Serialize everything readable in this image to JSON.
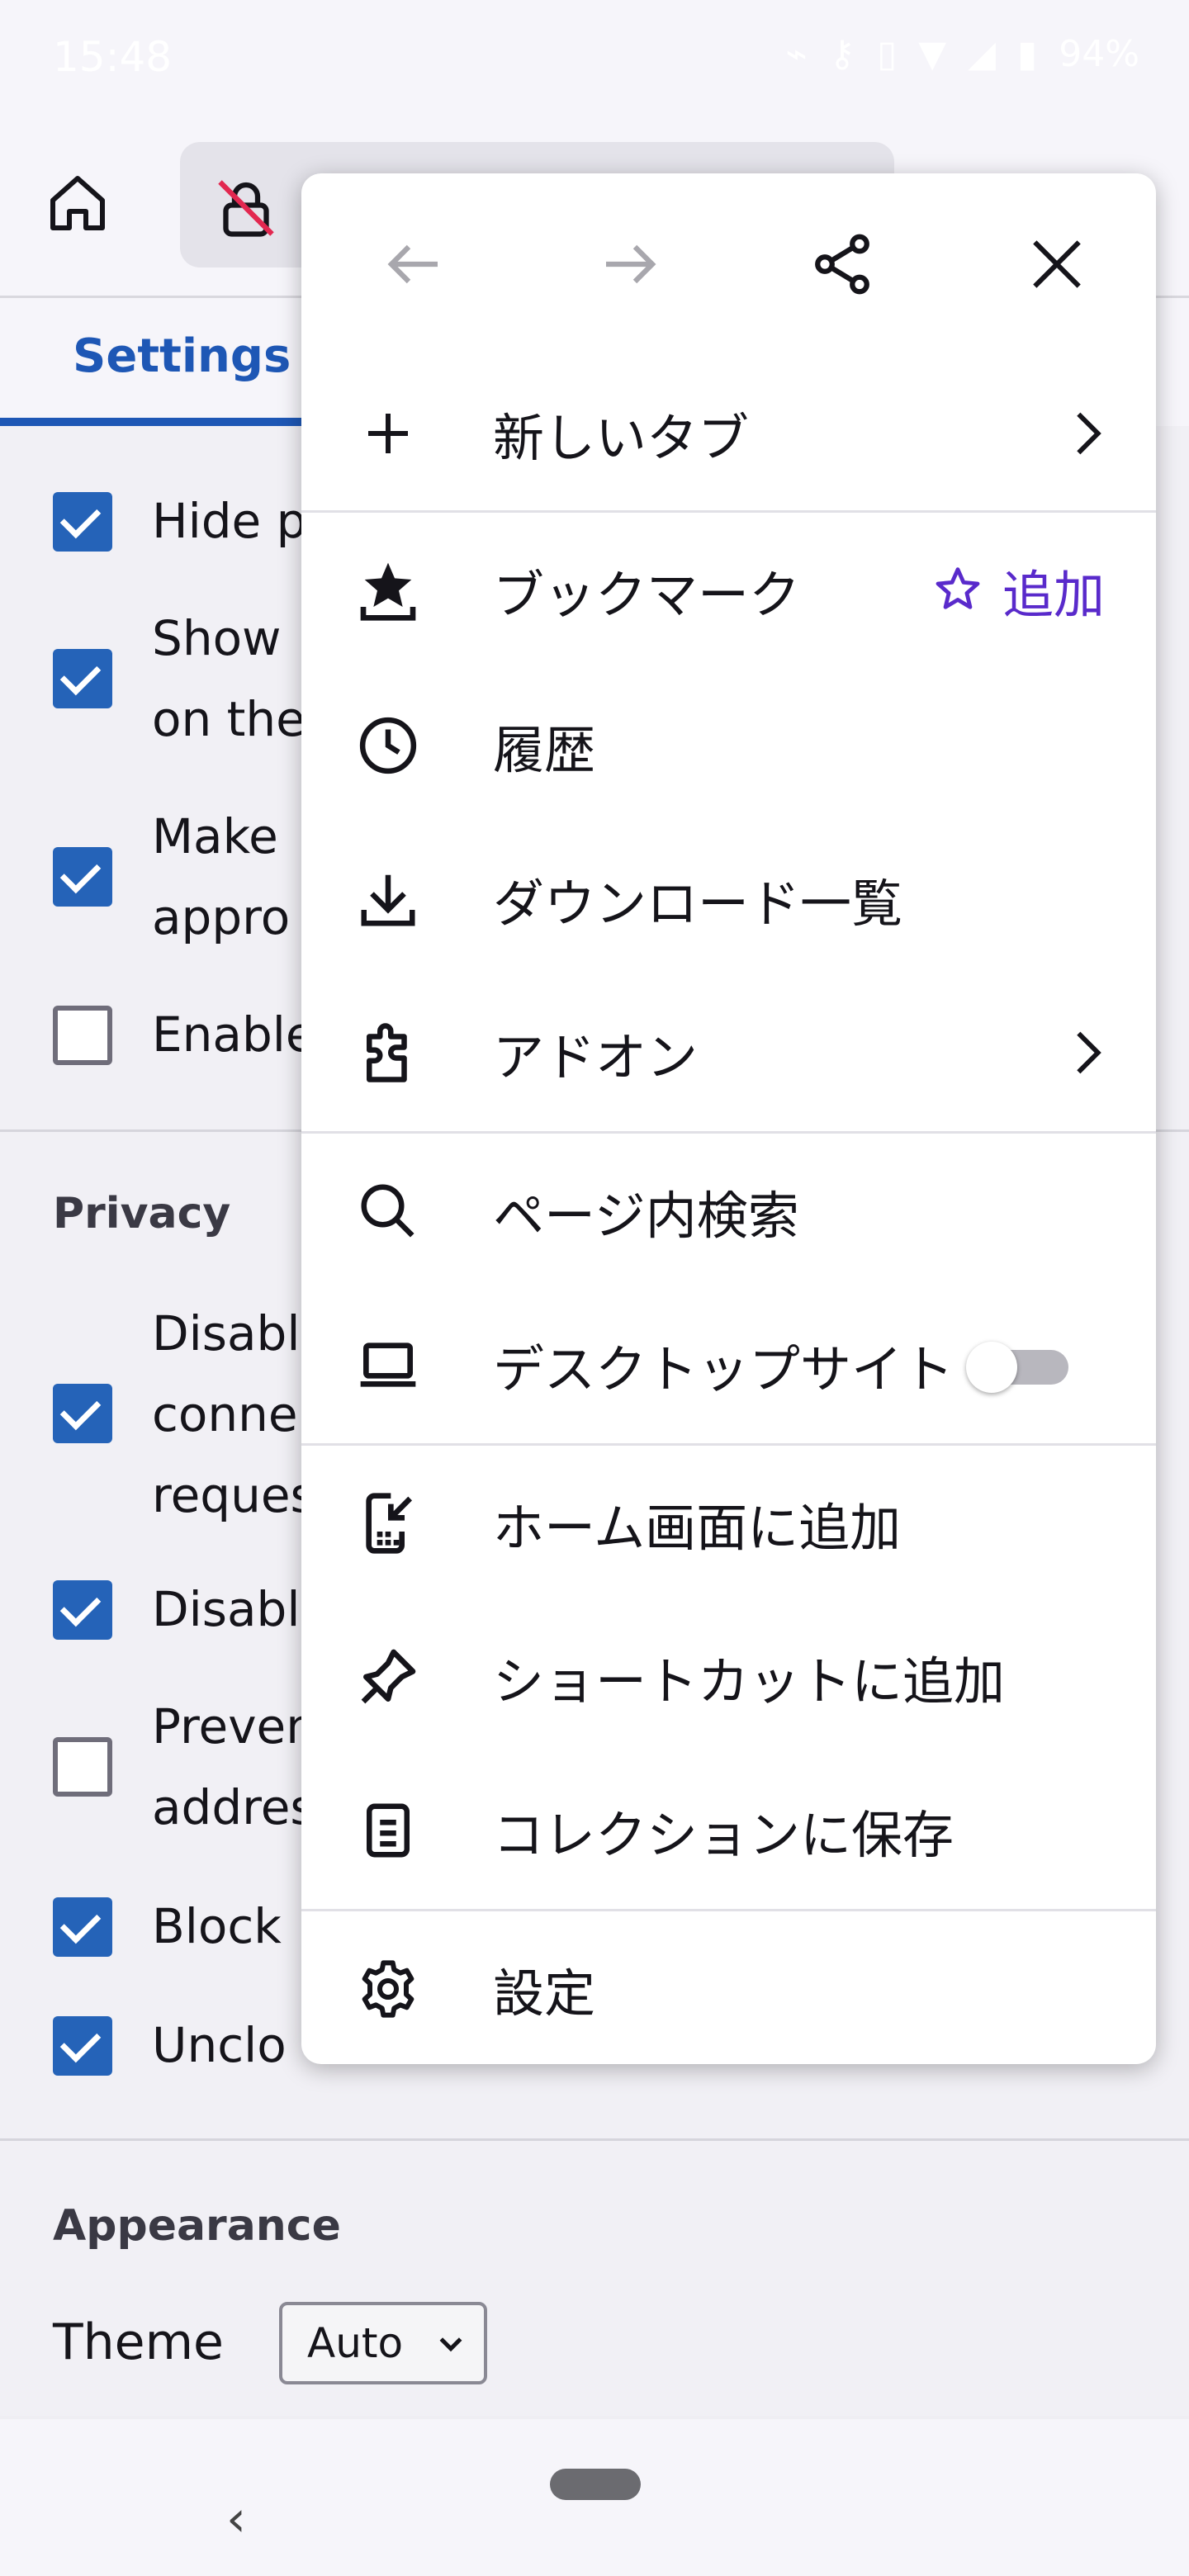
{
  "status_bar": {
    "time": "15:48",
    "battery": "94%"
  },
  "settings_page": {
    "tab_label": "Settings",
    "options_group1": [
      {
        "lines": [
          "Hide p"
        ],
        "checked": true
      },
      {
        "lines": [
          "Show",
          "on the"
        ],
        "checked": true
      },
      {
        "lines": [
          "Make",
          "appro"
        ],
        "checked": true
      },
      {
        "lines": [
          "Enable"
        ],
        "checked": false
      }
    ],
    "privacy_title": "Privacy",
    "options_privacy": [
      {
        "lines": [
          "Disabl",
          "conne",
          "reques"
        ],
        "checked": true
      },
      {
        "lines": [
          "Disabl"
        ],
        "checked": true
      },
      {
        "lines": [
          "Preven",
          "addres"
        ],
        "checked": false
      },
      {
        "lines": [
          "Block"
        ],
        "checked": true
      },
      {
        "lines": [
          "Unclo"
        ],
        "checked": true
      }
    ],
    "appearance_title": "Appearance",
    "theme_label": "Theme",
    "theme_value": "Auto"
  },
  "menu": {
    "items": {
      "new_tab": "新しいタブ",
      "bookmarks": "ブックマーク",
      "bookmark_add": "追加",
      "history": "履歴",
      "downloads": "ダウンロード一覧",
      "addons": "アドオン",
      "find_in_page": "ページ内検索",
      "desktop_site": "デスクトップサイト",
      "add_to_home": "ホーム画面に追加",
      "add_shortcut": "ショートカットに追加",
      "save_collection": "コレクションに保存",
      "settings": "設定"
    },
    "desktop_site_enabled": false
  },
  "colors": {
    "accent": "#592acb",
    "checkbox": "#2563b8",
    "tab": "#1e57b5"
  }
}
